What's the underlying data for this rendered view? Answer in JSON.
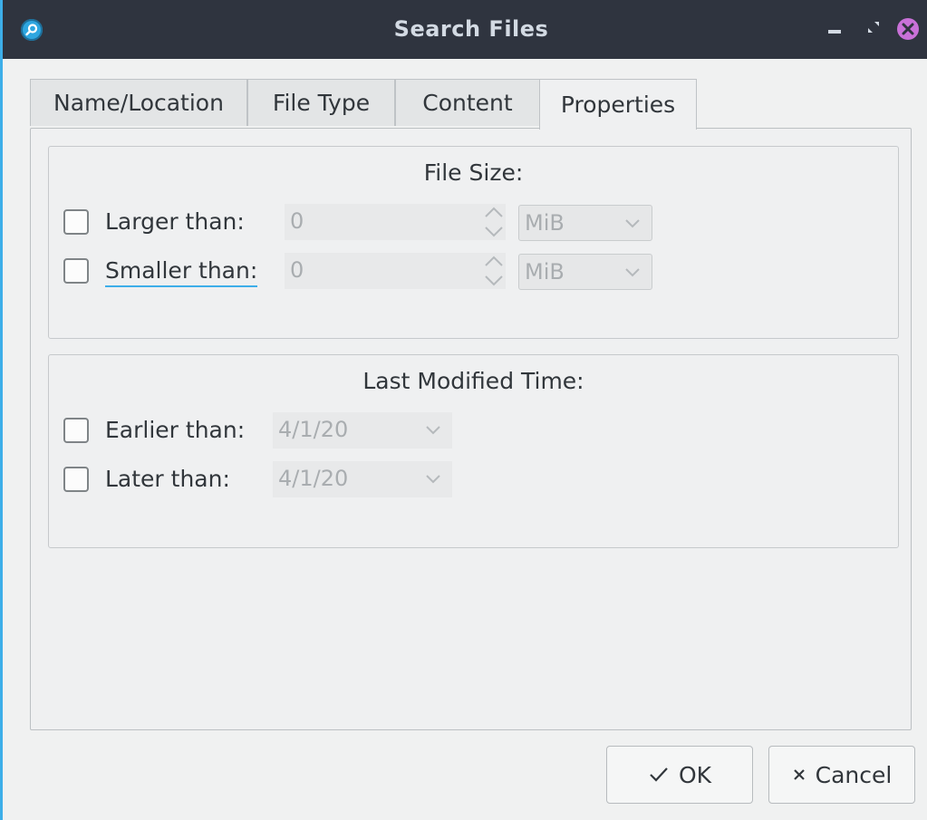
{
  "window": {
    "title": "Search Files",
    "icons": {
      "app": "search-app-icon",
      "minimize": "minimize-icon",
      "maximize": "maximize-icon",
      "close": "close-icon"
    }
  },
  "tabs": [
    {
      "label": "Name/Location",
      "active": false
    },
    {
      "label": "File Type",
      "active": false
    },
    {
      "label": "Content",
      "active": false
    },
    {
      "label": "Properties",
      "active": true
    }
  ],
  "file_size": {
    "title": "File Size:",
    "larger": {
      "label": "Larger than:",
      "checked": false,
      "value": "0",
      "unit": "MiB"
    },
    "smaller": {
      "label": "Smaller than:",
      "checked": false,
      "value": "0",
      "unit": "MiB"
    }
  },
  "modified": {
    "title": "Last Modified Time:",
    "earlier": {
      "label": "Earlier than:",
      "checked": false,
      "value": "4/1/20"
    },
    "later": {
      "label": "Later than:",
      "checked": false,
      "value": "4/1/20"
    }
  },
  "buttons": {
    "ok": {
      "label": "OK",
      "icon": "check-icon"
    },
    "cancel": {
      "label": "Cancel",
      "icon": "x-icon"
    }
  },
  "colors": {
    "accent": "#3daee9",
    "titlebar": "#2f343f",
    "close": "#c971d8"
  }
}
